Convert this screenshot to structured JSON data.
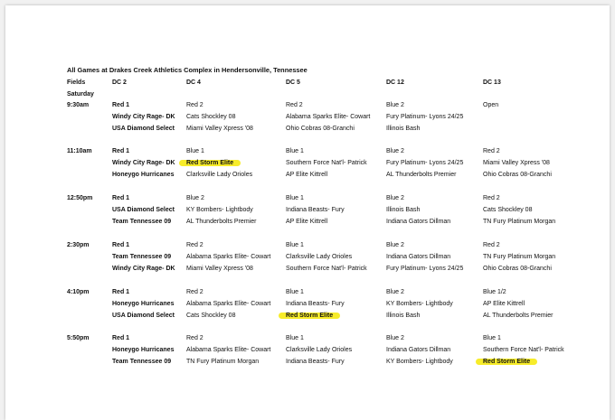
{
  "title": "All Games at Drakes Creek Athletics Complex in Hendersonville, Tennessee",
  "header": {
    "fields_label": "Fields",
    "day_label": "Saturday",
    "columns": [
      "DC 2",
      "DC 4",
      "DC 5",
      "DC 12",
      "DC 13"
    ]
  },
  "highlight_color": "#f7ec2a",
  "slots": [
    {
      "time": "9:30am",
      "fields": [
        {
          "lines": [
            "Red 1",
            "Windy City Rage- DK",
            "USA Diamond Select"
          ],
          "highlight": -1
        },
        {
          "lines": [
            "Red 2",
            "Cats Shockley 08",
            "Miami Valley Xpress '08"
          ],
          "highlight": -1
        },
        {
          "lines": [
            "Red 2",
            "Alabama Sparks Elite- Cowart",
            "Ohio Cobras 08-Granchi"
          ],
          "highlight": -1
        },
        {
          "lines": [
            "Blue 2",
            "Fury Platinum- Lyons 24/25",
            "Illinois Bash"
          ],
          "highlight": -1
        },
        {
          "lines": [
            "Open"
          ],
          "highlight": -1
        }
      ]
    },
    {
      "time": "11:10am",
      "fields": [
        {
          "lines": [
            "Red 1",
            "Windy City Rage- DK",
            "Honeygo Hurricanes"
          ],
          "highlight": -1
        },
        {
          "lines": [
            "Blue 1",
            "Red Storm Elite",
            "Clarksville Lady Orioles"
          ],
          "highlight": 1
        },
        {
          "lines": [
            "Blue 1",
            "Southern Force Nat'l- Patrick",
            "AP Elite Kittrell"
          ],
          "highlight": -1
        },
        {
          "lines": [
            "Blue 2",
            "Fury Platinum- Lyons 24/25",
            "AL Thunderbolts Premier"
          ],
          "highlight": -1
        },
        {
          "lines": [
            "Red 2",
            "Miami Valley Xpress '08",
            "Ohio Cobras 08-Granchi"
          ],
          "highlight": -1
        }
      ]
    },
    {
      "time": "12:50pm",
      "fields": [
        {
          "lines": [
            "Red 1",
            "USA Diamond Select",
            "Team Tennessee 09"
          ],
          "highlight": -1
        },
        {
          "lines": [
            "Blue 2",
            "KY Bombers- Lightbody",
            "AL Thunderbolts Premier"
          ],
          "highlight": -1
        },
        {
          "lines": [
            "Blue 1",
            "Indiana Beasts- Fury",
            "AP Elite Kittrell"
          ],
          "highlight": -1
        },
        {
          "lines": [
            "Blue 2",
            "Illinois Bash",
            "Indiana Gators Dillman"
          ],
          "highlight": -1
        },
        {
          "lines": [
            "Red 2",
            "Cats Shockley 08",
            "TN Fury Platinum Morgan"
          ],
          "highlight": -1
        }
      ]
    },
    {
      "time": "2:30pm",
      "fields": [
        {
          "lines": [
            "Red 1",
            "Team Tennessee 09",
            "Windy City Rage- DK"
          ],
          "highlight": -1
        },
        {
          "lines": [
            "Red 2",
            "Alabama Sparks Elite- Cowart",
            "Miami Valley Xpress '08"
          ],
          "highlight": -1
        },
        {
          "lines": [
            "Blue 1",
            "Clarksville Lady Orioles",
            "Southern Force Nat'l- Patrick"
          ],
          "highlight": -1
        },
        {
          "lines": [
            "Blue 2",
            "Indiana Gators Dillman",
            "Fury Platinum- Lyons 24/25"
          ],
          "highlight": -1
        },
        {
          "lines": [
            "Red 2",
            "TN Fury Platinum Morgan",
            "Ohio Cobras 08-Granchi"
          ],
          "highlight": -1
        }
      ]
    },
    {
      "time": "4:10pm",
      "fields": [
        {
          "lines": [
            "Red 1",
            "Honeygo Hurricanes",
            "USA Diamond Select"
          ],
          "highlight": -1
        },
        {
          "lines": [
            "Red 2",
            "Alabama Sparks Elite- Cowart",
            "Cats Shockley 08"
          ],
          "highlight": -1
        },
        {
          "lines": [
            "Blue 1",
            "Indiana Beasts- Fury",
            "Red Storm Elite"
          ],
          "highlight": 2
        },
        {
          "lines": [
            "Blue 2",
            "KY Bombers- Lightbody",
            "Illinois Bash"
          ],
          "highlight": -1
        },
        {
          "lines": [
            "Blue 1/2",
            "AP Elite Kittrell",
            "AL Thunderbolts Premier"
          ],
          "highlight": -1
        }
      ]
    },
    {
      "time": "5:50pm",
      "fields": [
        {
          "lines": [
            "Red 1",
            "Honeygo Hurricanes",
            "Team Tennessee 09"
          ],
          "highlight": -1
        },
        {
          "lines": [
            "Red 2",
            "Alabama Sparks Elite- Cowart",
            "TN Fury Platinum Morgan"
          ],
          "highlight": -1
        },
        {
          "lines": [
            "Blue 1",
            "Clarksville Lady Orioles",
            "Indiana Beasts- Fury"
          ],
          "highlight": -1
        },
        {
          "lines": [
            "Blue 2",
            "Indiana Gators Dillman",
            "KY Bombers- Lightbody"
          ],
          "highlight": -1
        },
        {
          "lines": [
            "Blue 1",
            "Southern Force Nat'l- Patrick",
            "Red Storm Elite"
          ],
          "highlight": 2
        }
      ]
    }
  ]
}
